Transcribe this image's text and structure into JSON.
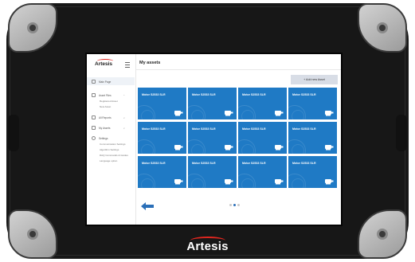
{
  "device": {
    "brand": "Artesis"
  },
  "sidebar": {
    "logo": "Artesis",
    "main_item": "Main Page",
    "items": [
      {
        "label": "Asset Files",
        "subitems": [
          "Registered Asset",
          "New Asset"
        ]
      },
      {
        "label": "All Reports",
        "subitems": []
      },
      {
        "label": "My Assets",
        "subitems": []
      },
      {
        "label": "Settings",
        "subitems": [
          "Communication Settings",
          "Algorithm Settings",
          "DAQ Commands & Guides",
          "Language option"
        ]
      }
    ]
  },
  "main": {
    "title": "My assets",
    "add_button": "+ Add new Asset",
    "assets": [
      "Motor S2533 SLR",
      "Motor S2533 SLR",
      "Motor S2533 SLR",
      "Motor S2533 SLR",
      "Motor S2533 SLR",
      "Motor S2533 SLR",
      "Motor S2533 SLR",
      "Motor S2533 SLR",
      "Motor S2533 SLR",
      "Motor S2533 SLR",
      "Motor S2533 SLR",
      "Motor S2533 SLR"
    ],
    "pagination": {
      "current_page": 2,
      "total_pages": 3
    }
  },
  "colors": {
    "card": "#1f7ac5",
    "accent": "#e0261f",
    "arrow": "#2a6fb8"
  },
  "icons": {
    "back": "arrow-left-icon",
    "menu": "hamburger-icon",
    "asset": "motor-icon"
  }
}
